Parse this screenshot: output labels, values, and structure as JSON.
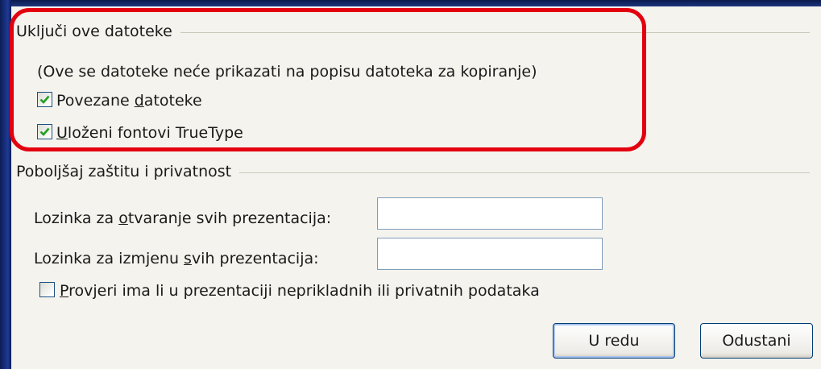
{
  "include_group": {
    "title": "Uključi ove datoteke",
    "note": "(Ove se datoteke neće prikazati na popisu datoteka za kopiranje)",
    "linked_files": {
      "label_pre": "Povezane ",
      "label_access": "d",
      "label_post": "atoteke",
      "checked": true
    },
    "embedded_fonts": {
      "label_pre": "",
      "label_access": "U",
      "label_post": "loženi fontovi TrueType",
      "checked": true
    }
  },
  "privacy_group": {
    "title": "Poboljšaj zaštitu i privatnost",
    "open_password": {
      "label_pre": "Lozinka za ",
      "label_access": "o",
      "label_post": "tvaranje svih prezentacija:",
      "value": ""
    },
    "modify_password": {
      "label_pre": "Lozinka za izmjenu ",
      "label_access": "s",
      "label_post": "vih prezentacija:",
      "value": ""
    },
    "inspect_check": {
      "label_pre": "",
      "label_access": "P",
      "label_post": "rovjeri ima li u prezentaciji neprikladnih ili privatnih podataka",
      "checked": false
    }
  },
  "buttons": {
    "ok": "U redu",
    "cancel": "Odustani"
  },
  "colors": {
    "highlight": "#e3000f",
    "dialog_bg": "#f4f3ee",
    "checkmark": "#21a121",
    "desktop": "#0f2160"
  }
}
